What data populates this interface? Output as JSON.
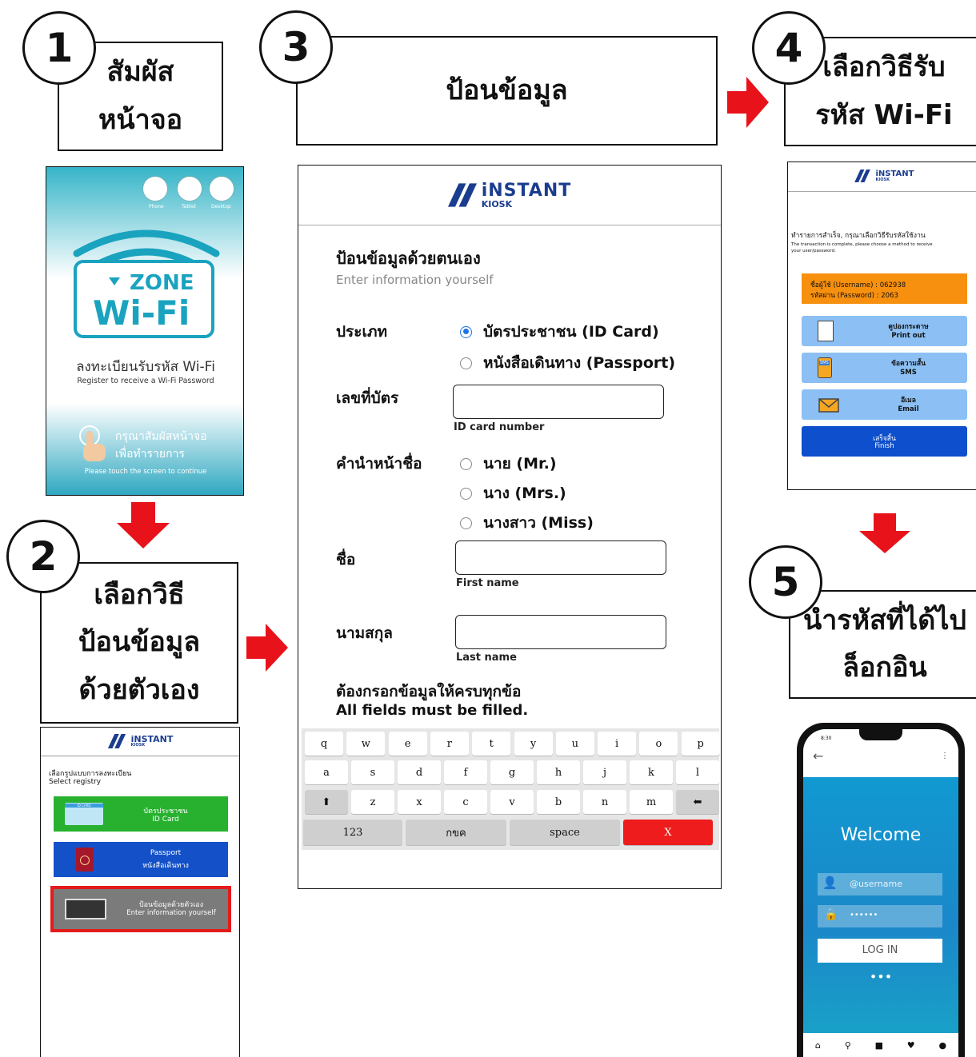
{
  "steps": {
    "s1": {
      "num": "1",
      "line1": "สัมผัส",
      "line2": "หน้าจอ"
    },
    "s2": {
      "num": "2",
      "line1": "เลือกวิธี",
      "line2": "ป้อนข้อมูล",
      "line3": "ด้วยตัวเอง"
    },
    "s3": {
      "num": "3",
      "line1": "ป้อนข้อมูล"
    },
    "s4": {
      "num": "4",
      "line1": "เลือกวิธีรับ",
      "line2": "รหัส Wi-Fi"
    },
    "s5": {
      "num": "5",
      "line1": "นำรหัสที่ได้ไป",
      "line2": "ล็อกอิน"
    }
  },
  "logo": {
    "brand": "iNSTANT",
    "sub": "KIOSK"
  },
  "panel1": {
    "devices": [
      "Phone",
      "Tablet",
      "Desktop"
    ],
    "zone": "ZONE",
    "wifi": "Wi-Fi",
    "register_th": "ลงทะเบียนรับรหัส Wi-Fi",
    "register_en": "Register to receive a Wi-Fi Password",
    "touch_th1": "กรุณาสัมผัสหน้าจอ",
    "touch_th2": "เพื่อทำรายการ",
    "touch_en": "Please touch the screen to continue"
  },
  "panel2": {
    "select_th": "เลือกรูปแบบการลงทะเบียน",
    "select_en": "Select registry",
    "btn_id_th": "บัตรประชาชน",
    "btn_id_en": "ID Card",
    "card_label": "ID CARD",
    "btn_pass_en": "Passport",
    "btn_pass_th": "หนังสือเดินทาง",
    "btn_self_th": "ป้อนข้อมูลด้วยตัวเอง",
    "btn_self_en": "Enter information yourself",
    "colors": {
      "green": "#27b12f",
      "blue": "#1451c9",
      "highlight": "#e41b1b"
    }
  },
  "form": {
    "heading_th": "ป้อนข้อมูลด้วยตนเอง",
    "heading_en": "Enter information yourself",
    "type_label": "ประเภท",
    "type_options": [
      {
        "label": "บัตรประชาชน (ID Card)",
        "selected": true
      },
      {
        "label": "หนังสือเดินทาง (Passport)",
        "selected": false
      }
    ],
    "idnum_label": "เลขที่บัตร",
    "idnum_hint": "ID card number",
    "title_label": "คำนำหน้าชื่อ",
    "title_options": [
      "นาย (Mr.)",
      "นาง (Mrs.)",
      "นางสาว (Miss)"
    ],
    "first_label": "ชื่อ",
    "first_hint": "First name",
    "last_label": "นามสกุล",
    "last_hint": "Last name",
    "required_th": "ต้องกรอกข้อมูลให้ครบทุกข้อ",
    "required_en": "All fields must be filled."
  },
  "keyboard": {
    "row1": [
      "q",
      "w",
      "e",
      "r",
      "t",
      "y",
      "u",
      "i",
      "o",
      "p"
    ],
    "row2": [
      "a",
      "s",
      "d",
      "f",
      "g",
      "h",
      "j",
      "k",
      "l"
    ],
    "row3": [
      "⬆",
      "z",
      "x",
      "c",
      "v",
      "b",
      "n",
      "m",
      "⬅"
    ],
    "row4": [
      "123",
      "กขค",
      "space",
      "X"
    ]
  },
  "panel4": {
    "msg_th": "ทำรายการสำเร็จ, กรุณาเลือกวิธีรับรหัสใช้งาน",
    "msg_en1": "The transaction is complete, please choose a method to receive",
    "msg_en2": "your user/password.",
    "user_line": "ชื่อผู้ใช้ (Username)   : 062938",
    "pass_line": "รหัสผ่าน (Password)  : 2063",
    "opt_print_th": "คูปองกระดาษ",
    "opt_print_en": "Print out",
    "opt_sms_th": "ข้อความสั้น",
    "opt_sms_en": "SMS",
    "sms_icon_text": "SMS",
    "opt_email_th": "อีเมล",
    "opt_email_en": "Email",
    "finish_th": "เสร็จสิ้น",
    "finish_en": "Finish",
    "colors": {
      "orange": "#f7900f",
      "option": "#8cc0f4",
      "finish": "#0d4fcc"
    }
  },
  "phone": {
    "time": "8:30",
    "welcome": "Welcome",
    "username_placeholder": "@username",
    "password_mask": "••••••",
    "login_label": "LOG IN",
    "dots": "•••"
  },
  "accent": {
    "arrow": "#e8121b"
  }
}
